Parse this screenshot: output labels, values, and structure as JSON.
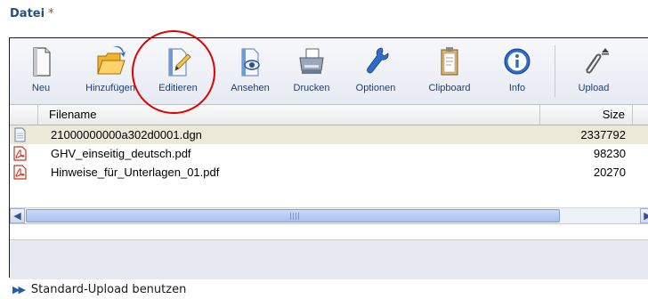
{
  "title": "Datei",
  "title_marker": "*",
  "toolbar": {
    "buttons": [
      {
        "label": "Neu",
        "icon": "new-file-icon"
      },
      {
        "label": "Hinzufügen",
        "icon": "open-folder-icon"
      },
      {
        "label": "Editieren",
        "icon": "edit-pencil-icon"
      },
      {
        "label": "Ansehen",
        "icon": "view-eye-icon"
      },
      {
        "label": "Drucken",
        "icon": "printer-icon"
      },
      {
        "label": "Optionen",
        "icon": "wrench-icon"
      },
      {
        "label": "Clipboard",
        "icon": "clipboard-icon"
      },
      {
        "label": "Info",
        "icon": "info-icon"
      },
      {
        "label": "Upload",
        "icon": "paperclip-upload-icon"
      }
    ]
  },
  "table": {
    "columns": {
      "name": "Filename",
      "size": "Size"
    },
    "rows": [
      {
        "name": "21000000000a302d0001.dgn",
        "size": "2337792",
        "icon": "document-icon",
        "selected": true
      },
      {
        "name": "GHV_einseitig_deutsch.pdf",
        "size": "98230",
        "icon": "pdf-icon",
        "selected": false
      },
      {
        "name": "Hinweise_für_Unterlagen_01.pdf",
        "size": "20270",
        "icon": "pdf-icon",
        "selected": false
      }
    ]
  },
  "footer_link": "Standard-Upload benutzen",
  "colors": {
    "accent": "#2a4f7d",
    "highlight_circle": "#e00000",
    "selected_row": "#ece9d8"
  }
}
